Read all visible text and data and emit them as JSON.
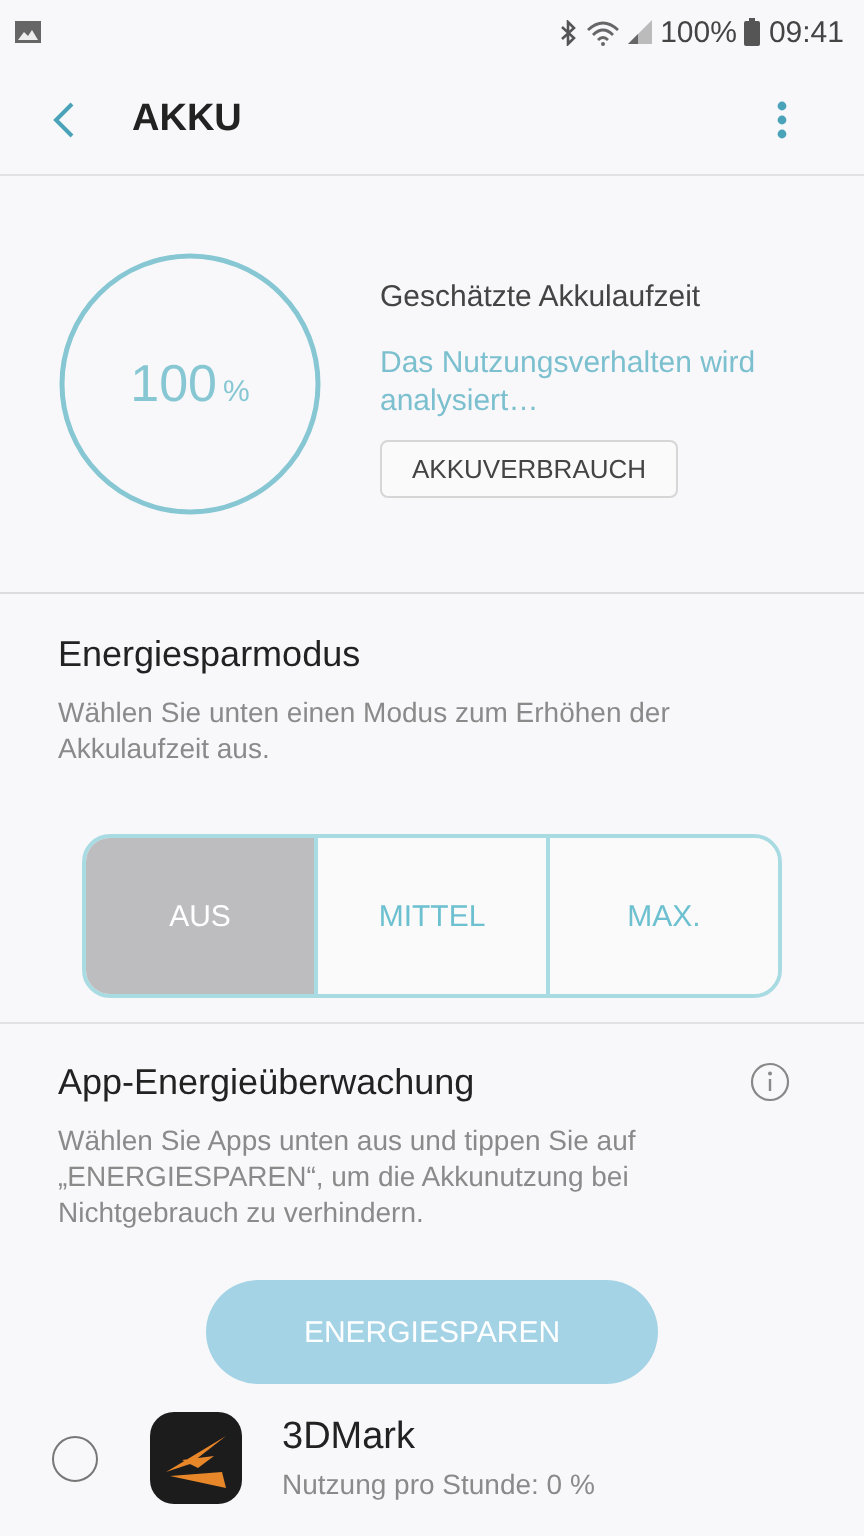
{
  "status_bar": {
    "battery": "100%",
    "time": "09:41"
  },
  "header": {
    "title": "AKKU"
  },
  "battery": {
    "value": "100",
    "unit": "%",
    "level": 1,
    "label": "Geschätzte Akkulaufzeit",
    "status": "Das Nutzungsverhalten wird analysiert…",
    "button": "AKKUVERBRAUCH"
  },
  "power_saving": {
    "title": "Energiesparmodus",
    "description": "Wählen Sie unten einen Modus zum Erhöhen der Akkulaufzeit aus.",
    "modes": [
      {
        "label": "AUS",
        "selected": true
      },
      {
        "label": "MITTEL",
        "selected": false
      },
      {
        "label": "MAX.",
        "selected": false
      }
    ]
  },
  "app_monitor": {
    "title": "App-Energieüberwachung",
    "description": "Wählen Sie Apps unten aus und tippen Sie auf „ENERGIESPAREN“, um die Akkunutzung bei Nichtgebrauch zu verhindern.",
    "button": {
      "label": "ENERGIESPAREN",
      "disabled": true
    },
    "apps": [
      {
        "name": "3DMark",
        "usage": "Nutzung pro Stunde: 0 %",
        "checked": false
      }
    ]
  }
}
